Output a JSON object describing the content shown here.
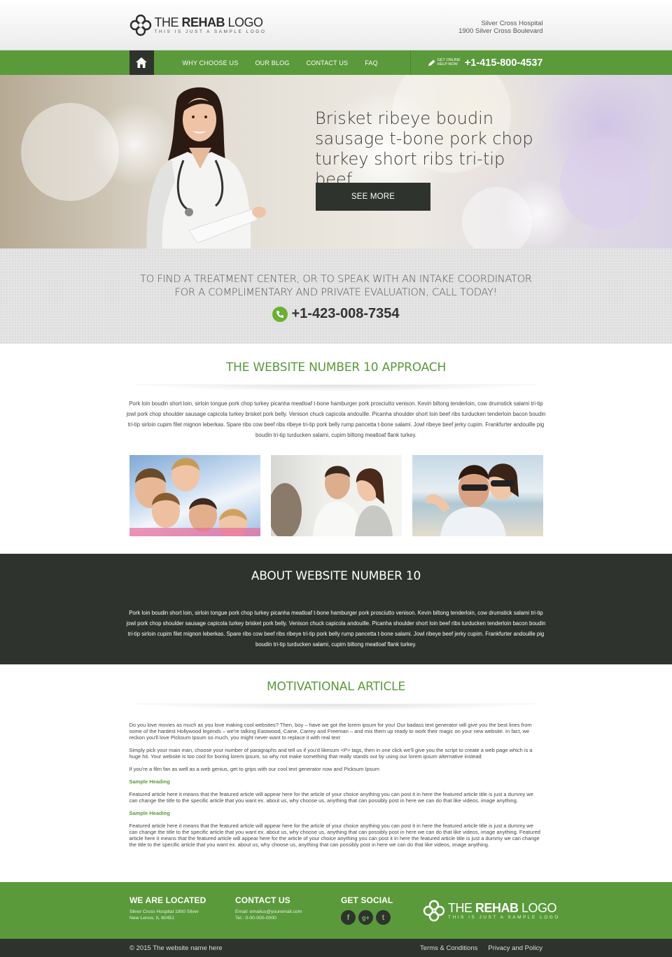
{
  "header": {
    "logo": {
      "title_light": "THE ",
      "title_bold": "REHAB",
      "title_end": " LOGO",
      "tagline": "THIS IS JUST A SAMPLE LOGO"
    },
    "address_line1": "Silver Cross Hospital",
    "address_line2": "1900 Silver Cross Boulevard"
  },
  "nav": {
    "home_icon": "home-icon",
    "items": [
      {
        "label": "WHY CHOOSE US"
      },
      {
        "label": "OUR BLOG"
      },
      {
        "label": "CONTACT US"
      },
      {
        "label": "FAQ"
      }
    ],
    "help_line1": "GET ONLINE",
    "help_line2": "HELP NOW",
    "phone": "+1-415-800-4537"
  },
  "hero": {
    "headline": "Brisket ribeye boudin sausage t-bone pork chop turkey short ribs tri-tip beef.",
    "button": "SEE MORE"
  },
  "call": {
    "line1": "TO FIND A TREATMENT CENTER, OR TO SPEAK WITH AN INTAKE COORDINATOR",
    "line2": "FOR A COMPLIMENTARY AND PRIVATE EVALUATION, CALL TODAY!",
    "phone": "+1-423-008-7354"
  },
  "approach": {
    "title": "THE WEBSITE NUMBER 10 APPROACH",
    "paragraph": "Pork loin boudin short loin, sirloin tongue pork chop turkey picanha meatloaf t-bone hamburger pork prosciutto venison. Kevin biltong tenderloin, cow drumstick salami tri-tip jowl pork chop shoulder sausage capicola turkey brisket pork belly. Venison chuck capicola andouille. Picanha shoulder short loin beef ribs turducken tenderloin bacon boudin tri-tip sirloin cupim filet mignon leberkas. Spare ribs cow beef ribs ribeye tri-tip pork belly rump pancetta t-bone salami. Jowl ribeye beef jerky cupim. Frankfurter andouille pig boudin tri-tip turducken salami, cupim biltong meatloaf flank turkey."
  },
  "about": {
    "title": "ABOUT WEBSITE NUMBER 10",
    "paragraph": "Pork loin boudin short loin, sirloin tongue pork chop turkey picanha meatloaf t-bone hamburger pork prosciutto venison. Kevin biltong tenderloin, cow drumstick salami tri-tip jowl pork chop shoulder sausage capicola turkey brisket pork belly. Venison chuck capicola andouille. Picanha shoulder short loin beef ribs turducken tenderloin bacon boudin tri-tip sirloin cupim filet mignon leberkas. Spare ribs cow beef ribs ribeye tri-tip pork belly rump pancetta t-bone salami. Jowl ribeye beef jerky cupim. Frankfurter andouille pig boudin tri-tip turducken salami, cupim biltong meatloaf flank turkey."
  },
  "article": {
    "title": "MOTIVATIONAL ARTICLE",
    "p1": "Do you love movies as much as you love making cool websites? Then, boy – have we got the lorem ipsum for you! Our badass text generator will give you the best lines from some of the hardest Hollywood legends – we're talking Eastwood, Caine, Carrey and Freeman – and mix them up ready to work their magic on your new website. In fact, we reckon you'll love Picksum Ipsum so much, you might never want to replace it with real text",
    "p2": "Simply pick your main man, choose your number of paragraphs and tell us if you'd likesum <P> tags, then in one click we'll give you the script to create a web page which is a huge hit. Your website is too cool for boring lorem ipsum, so why not make something that really stands out by using our lorem ipsum alternative instead",
    "p3": "If you're a film fan as well as a web genius, get to grips with our cool text generator now and Picksum Ipsum",
    "heading1": "Sample Heading",
    "p4": "Featured article here it means that the featured article will appear here for the article of your choice anything you can post it in here the featured article title is just a dummy we can change the title to the specific article that you want ex. about us, why choose us, anything that can possibly post in here we can do that like videos, image anything.",
    "heading2": "Sample Heading",
    "p5": "Featured article here it means that the featured article will appear here for the article of your choice anything you can post it in here the featured article title is just a dummy we can change the title to the specific article that you want ex. about us, why choose us, anything that can possibly post in here we can do that like videos, image anything. Featured article here it means that the featured article will appear here for the article of your choice anything you can post it in here the featured article title is just a dummy we can change the title to the specific article that you want ex. about us, why choose us, anything that can possibly post in here we can do that like videos, image anything."
  },
  "footer": {
    "located_title": "WE ARE LOCATED",
    "located_line1": "Silver Cross Hospital 1900 Silver",
    "located_line2": "New Lenox, IL 60451",
    "contact_title": "CONTACT US",
    "contact_email": "Email: emailus@youremail.com",
    "contact_tel": "Tel.: 0-00-000-0000",
    "social_title": "GET SOCIAL",
    "social_icons": [
      "facebook-icon",
      "google-plus-icon",
      "twitter-icon"
    ],
    "social_glyphs": [
      "f",
      "g+",
      "t"
    ],
    "logo": {
      "title_light": "THE ",
      "title_bold": "REHAB",
      "title_end": " LOGO",
      "tagline": "THIS IS JUST A SAMPLE LOGO"
    }
  },
  "bottom": {
    "copyright": "© 2015 The website name here",
    "terms": "Terms & Conditions",
    "privacy": "Privacy and Policy"
  },
  "colors": {
    "green": "#5a9a3b",
    "dark": "#2e332d"
  }
}
